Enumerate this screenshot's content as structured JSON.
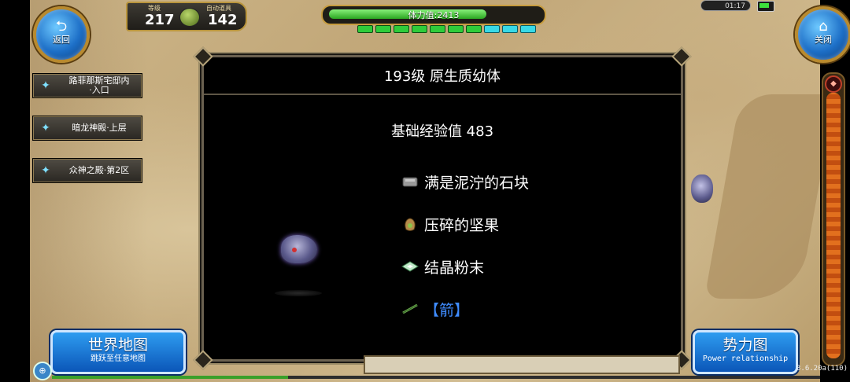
{
  "top_left": {
    "back_label": "返回",
    "level_caption": "等级",
    "level_value": "217",
    "auto_item_caption": "自动道具",
    "auto_item_value": "142"
  },
  "stamina": {
    "label": "体力值:2413",
    "fill_fraction": 0.75
  },
  "clock": "01:17",
  "top_right": {
    "close_label": "关闭"
  },
  "quests": [
    {
      "line1": "路菲那斯宅邸内",
      "line2": "·入口"
    },
    {
      "line1": "暗龙神殿·上层",
      "line2": ""
    },
    {
      "line1": "众神之殿·第2区",
      "line2": ""
    }
  ],
  "dialog": {
    "title": "193级 原生质幼体",
    "exp": "基础经验值 483",
    "drops": [
      {
        "name": "满是泥泞的石块",
        "icon": "stone-icon"
      },
      {
        "name": "压碎的坚果",
        "icon": "nut-bag-icon"
      },
      {
        "name": "结晶粉末",
        "icon": "powder-icon"
      },
      {
        "name": "【箭】",
        "icon": "arrow-icon"
      }
    ]
  },
  "buttons": {
    "world_map_label": "世界地图",
    "world_map_sub": "跳跃至任意地图",
    "power_label": "势力图",
    "power_sub": "Power relationship"
  },
  "version": "3.6.20a(110)",
  "colors": {
    "accent_blue": "#1d6fc7",
    "drop_highlight": "#3f8cff",
    "stamina_green": "#2aa520"
  }
}
